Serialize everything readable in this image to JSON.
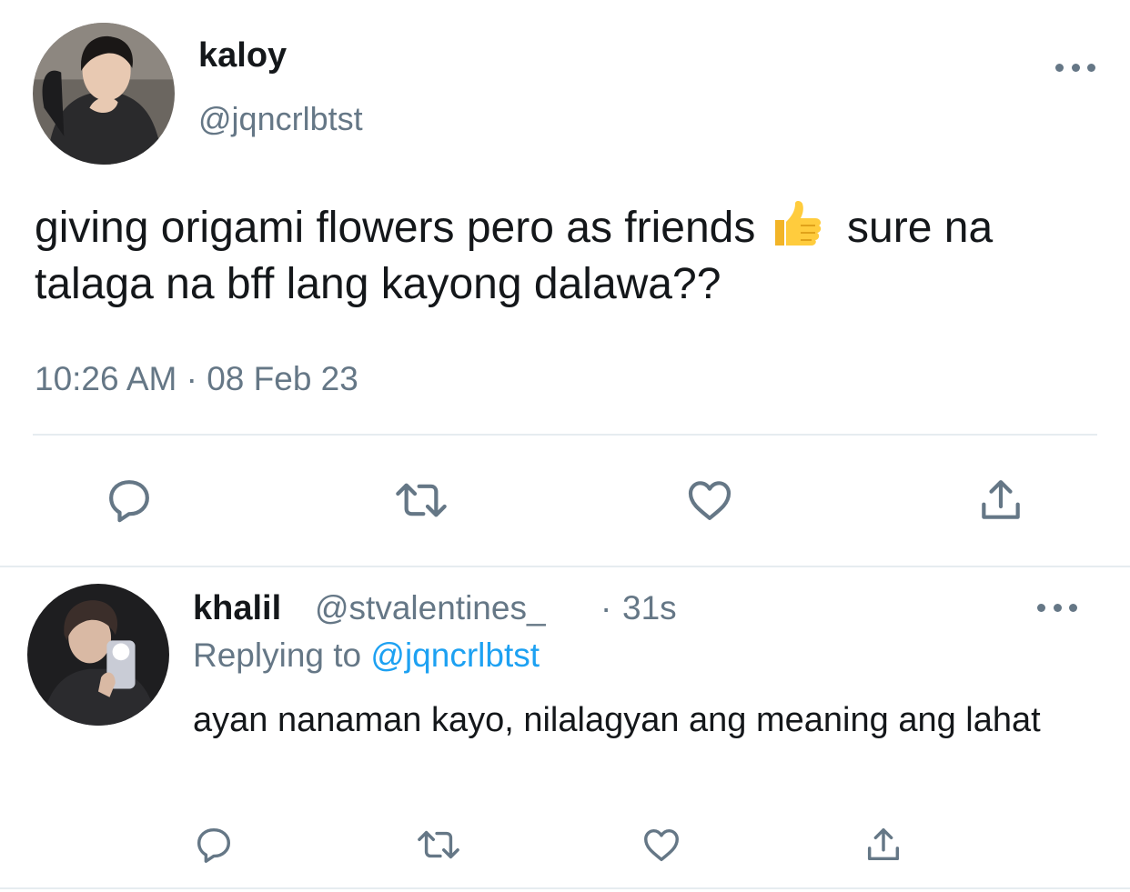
{
  "tweet": {
    "author_name": "kaloy",
    "author_handle": "@jqncrlbtst",
    "text_before_emoji": "giving origami flowers pero as friends",
    "emoji_icon": "thumbs-up-icon",
    "text_after_emoji": "sure na talaga na bff lang kayong dalawa??",
    "timestamp": "10:26 AM · 08 Feb 23",
    "actions": [
      "reply-icon",
      "retweet-icon",
      "like-icon",
      "share-icon"
    ]
  },
  "reply": {
    "author_name": "khalil",
    "author_handle": "@stvalentines_",
    "separator": "·",
    "time_ago": "31s",
    "replying_label": "Replying to",
    "replying_handle": "@jqncrlbtst",
    "text": "ayan nanaman kayo, nilalagyan ang meaning ang lahat",
    "actions": [
      "reply-icon",
      "retweet-icon",
      "like-icon",
      "share-icon"
    ]
  },
  "colors": {
    "text_primary": "#14171a",
    "text_secondary": "#657786",
    "link": "#1da1f2",
    "divider": "#e6ecf0"
  }
}
